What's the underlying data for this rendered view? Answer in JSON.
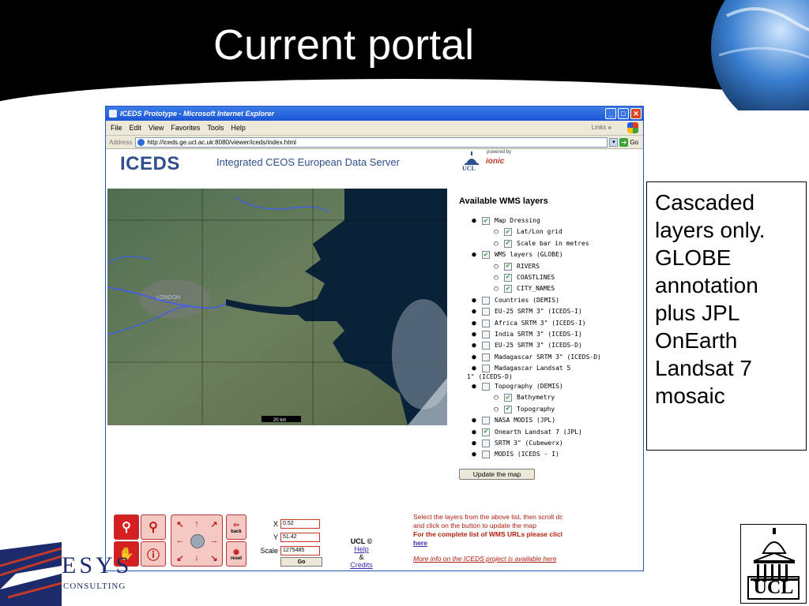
{
  "slide": {
    "title": "Current portal"
  },
  "browser": {
    "window_title": "ICEDS Prototype - Microsoft Internet Explorer",
    "menu": [
      "File",
      "Edit",
      "View",
      "Favorites",
      "Tools",
      "Help"
    ],
    "links_label": "Links",
    "links_chevron": "»",
    "address_label": "Address",
    "address_url": "http://iceds.ge.ucl.ac.uk:8080/viewer/iceds/index.html",
    "go_label": "Go"
  },
  "portal": {
    "logo": "ICEDS",
    "subtitle": "Integrated CEOS European Data Server",
    "ucl_mini": "UCL",
    "powered_by": "powered by",
    "ionic": "ionic",
    "map_scale_label": "20 km",
    "map_city_label": "LONDON",
    "layers_title": "Available WMS layers",
    "layers": [
      {
        "level": 0,
        "checked": true,
        "label": "Map Dressing"
      },
      {
        "level": 1,
        "checked": true,
        "label": "Lat/Lon grid"
      },
      {
        "level": 1,
        "checked": true,
        "label": "Scale bar in metres"
      },
      {
        "level": 0,
        "checked": true,
        "label": "WMS layers (GLOBE)"
      },
      {
        "level": 1,
        "checked": true,
        "label": "RIVERS"
      },
      {
        "level": 1,
        "checked": true,
        "label": "COASTLINES"
      },
      {
        "level": 1,
        "checked": true,
        "label": "CITY_NAMES"
      },
      {
        "level": 0,
        "checked": false,
        "label": "Countries (DEMIS)"
      },
      {
        "level": 0,
        "checked": false,
        "label": "EU-25 SRTM 3\" (ICEDS-I)"
      },
      {
        "level": 0,
        "checked": false,
        "label": "Africa SRTM 3\" (ICEDS-I)"
      },
      {
        "level": 0,
        "checked": false,
        "label": "India SRTM 3\" (ICEDS-I)"
      },
      {
        "level": 0,
        "checked": false,
        "label": "EU-25 SRTM 3\" (ICEDS-D)"
      },
      {
        "level": 0,
        "checked": false,
        "label": "Madagascar SRTM 3\" (ICEDS-D)"
      },
      {
        "level": 0,
        "checked": false,
        "label": "Madagascar Landsat 5",
        "label2": "1\" (ICEDS-D)"
      },
      {
        "level": 0,
        "checked": false,
        "label": "Topography (DEMIS)"
      },
      {
        "level": 1,
        "checked": true,
        "label": "Bathymetry"
      },
      {
        "level": 1,
        "checked": true,
        "label": "Topography"
      },
      {
        "level": 0,
        "checked": false,
        "label": "NASA MODIS (JPL)"
      },
      {
        "level": 0,
        "checked": true,
        "label": "Onearth Landsat 7 (JPL)"
      },
      {
        "level": 0,
        "checked": false,
        "label": "SRTM 3\" (Cubewerx)"
      },
      {
        "level": 0,
        "checked": false,
        "label": "MODIS (ICEDS - I)"
      }
    ],
    "update_button": "Update the map",
    "coords": {
      "x_label": "X",
      "x_value": "0.52",
      "y_label": "Y",
      "y_value": "51.42",
      "scale_label": "Scale",
      "scale_value": "1275485",
      "go_label": "Go"
    },
    "tools": {
      "back_label": "back",
      "reset_label": "reset"
    },
    "ucl_links": {
      "copyright": "UCL ©",
      "help": "Help",
      "amp": "&",
      "credits": "Credits"
    },
    "info": {
      "line1": "Select the layers from the above list, then scroll dc",
      "line2": "and click on the button to update the map",
      "bold_line": "For the complete list of WMS URLs please clicl",
      "here": "here",
      "more": "More info on the ICEDS project is available here"
    }
  },
  "callout": {
    "lines": [
      "Cascaded",
      "layers only.",
      "GLOBE",
      "annotation",
      "plus JPL",
      "OnEarth",
      "Landsat 7",
      "mosaic"
    ]
  },
  "footer": {
    "esys": "ESYS",
    "consulting": "CONSULTING",
    "ucl": "UCL"
  },
  "colors": {
    "header_bg": "#000000",
    "portal_blue": "#2f4e8c",
    "info_red": "#b02010",
    "link_blue": "#3a2faa"
  }
}
